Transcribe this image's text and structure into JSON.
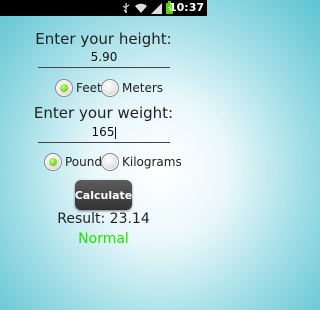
{
  "status_bar": {
    "time": "10:37",
    "icons": [
      "usb-icon",
      "wifi-icon",
      "signal-icon",
      "battery-charging-icon"
    ]
  },
  "height": {
    "label": "Enter your height:",
    "value": "5.90",
    "units": [
      {
        "label": "Feet",
        "selected": true
      },
      {
        "label": "Meters",
        "selected": false
      }
    ]
  },
  "weight": {
    "label": "Enter your weight:",
    "value": "165",
    "units": [
      {
        "label": "Pounds",
        "selected": true
      },
      {
        "label": "Kilograms",
        "selected": false
      }
    ]
  },
  "calculate_label": "Calculate",
  "result": {
    "text": "Result: 23.14",
    "category": "Normal",
    "category_color": "#22e000"
  }
}
